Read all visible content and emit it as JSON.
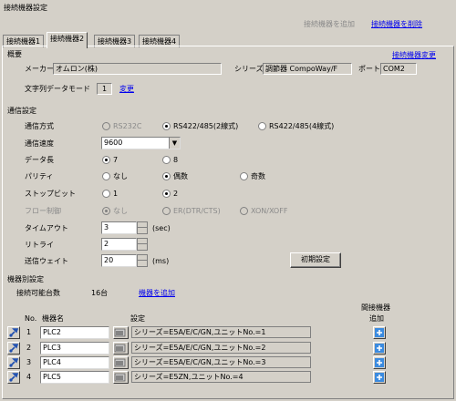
{
  "window_title": "接続機器設定",
  "top_actions": {
    "add_device": "接続機器を追加",
    "delete_device": "接続機器を削除"
  },
  "tabs": [
    "接続機器1",
    "接続機器2",
    "接続機器3",
    "接続機器4"
  ],
  "active_tab": 1,
  "overview": {
    "heading": "概要",
    "change_link": "接続機器変更",
    "maker_label": "メーカー",
    "maker_value": "オムロン(株)",
    "series_label": "シリーズ",
    "series_value": "調節器 CompoWay/F",
    "port_label": "ポート",
    "port_value": "COM2",
    "text_mode_label": "文字列データモード",
    "text_mode_value": "1",
    "text_mode_change": "変更"
  },
  "comm": {
    "heading": "通信設定",
    "method_label": "通信方式",
    "method_options": [
      "RS232C",
      "RS422/485(2線式)",
      "RS422/485(4線式)"
    ],
    "method_selected": 1,
    "speed_label": "通信速度",
    "speed_value": "9600",
    "data_len_label": "データ長",
    "data_len_options": [
      "7",
      "8"
    ],
    "data_len_selected": 0,
    "parity_label": "パリティ",
    "parity_options": [
      "なし",
      "偶数",
      "奇数"
    ],
    "parity_selected": 1,
    "stop_label": "ストップビット",
    "stop_options": [
      "1",
      "2"
    ],
    "stop_selected": 1,
    "flow_label": "フロー制御",
    "flow_options": [
      "なし",
      "ER(DTR/CTS)",
      "XON/XOFF"
    ],
    "flow_selected": 0,
    "timeout_label": "タイムアウト",
    "timeout_value": "3",
    "timeout_unit": "(sec)",
    "retry_label": "リトライ",
    "retry_value": "2",
    "wait_label": "送信ウェイト",
    "wait_value": "20",
    "wait_unit": "(ms)",
    "init_button": "初期設定"
  },
  "devices": {
    "heading": "機器別設定",
    "count_label": "接続可能台数",
    "count_value": "16台",
    "add_link": "機器を追加",
    "indirect_header_1": "間接機器",
    "indirect_header_2": "追加",
    "col_no": "No.",
    "col_name": "機器名",
    "col_setting": "設定",
    "rows": [
      {
        "no": "1",
        "name": "PLC2",
        "setting": "シリーズ=E5A/E/C/GN,ユニットNo.=1"
      },
      {
        "no": "2",
        "name": "PLC3",
        "setting": "シリーズ=E5A/E/C/GN,ユニットNo.=2"
      },
      {
        "no": "3",
        "name": "PLC4",
        "setting": "シリーズ=E5A/E/C/GN,ユニットNo.=3"
      },
      {
        "no": "4",
        "name": "PLC5",
        "setting": "シリーズ=E5ZN,ユニットNo.=4"
      }
    ]
  }
}
